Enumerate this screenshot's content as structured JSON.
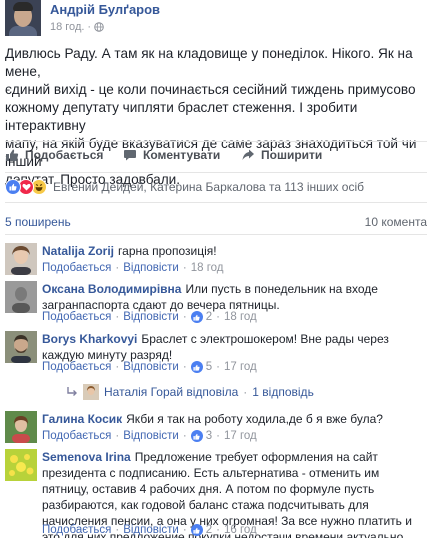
{
  "post": {
    "author": "Андрій Булґаров",
    "time": "18 год.",
    "text": "Дивлюсь Раду. А там як на кладовище у понеділок. Нікого. Як на мене,\nєдиний вихід - це коли починається сесійний тиждень примусово\nкожному депутату чипляти браслет стеження. І зробити інтерактивну\nмапу, на якій буде вказуватися де саме зараз знаходиться той чи інший\nдепутат. Просто задовбали."
  },
  "actions": {
    "like": "Подобається",
    "comment": "Коментувати",
    "share": "Поширити"
  },
  "reactions": {
    "names": "Евгений Дейдей, Катерина Баркалова та 113 інших осіб"
  },
  "stats": {
    "shares": "5 поширень",
    "comments": "10 комента"
  },
  "labels": {
    "like": "Подобається",
    "reply": "Відповісти",
    "sep": "·"
  },
  "comments": [
    {
      "name": "Natalija Zorij",
      "text": "гарна пропозиція!",
      "likes": "",
      "time": "18 год"
    },
    {
      "name": "Оксана Володимирівна",
      "text": "Или пусть в понедельник на входе загранпаспорта сдают до вечера пятницы.",
      "likes": "2",
      "time": "18 год"
    },
    {
      "name": "Borys Kharkovyi",
      "text": "Браслет с электрошокером! Вне рады через каждую минуту разряд!",
      "likes": "5",
      "time": "17 год"
    },
    {
      "name": "Галина Косик",
      "text": "Якби я так на роботу ходила,де б я вже була?",
      "likes": "3",
      "time": "17 год"
    },
    {
      "name": "Semenova Irina",
      "text": "Предложение требует оформления на сайт президента с подписанию. Есть альтернатива - отменить им пятницу, оставив 4 рабочих дня. А потом по формуле пусть разбираются, как годовой баланс стажа подсчитывать для начисления пенсии, а она у них огромная! За все нужно платить и это для них предложение покупки недостачи времени актуально",
      "likes": "2",
      "time": "16 год"
    }
  ],
  "reply": {
    "text": "Наталія Горай відповіла",
    "count": "1 відповідь"
  }
}
